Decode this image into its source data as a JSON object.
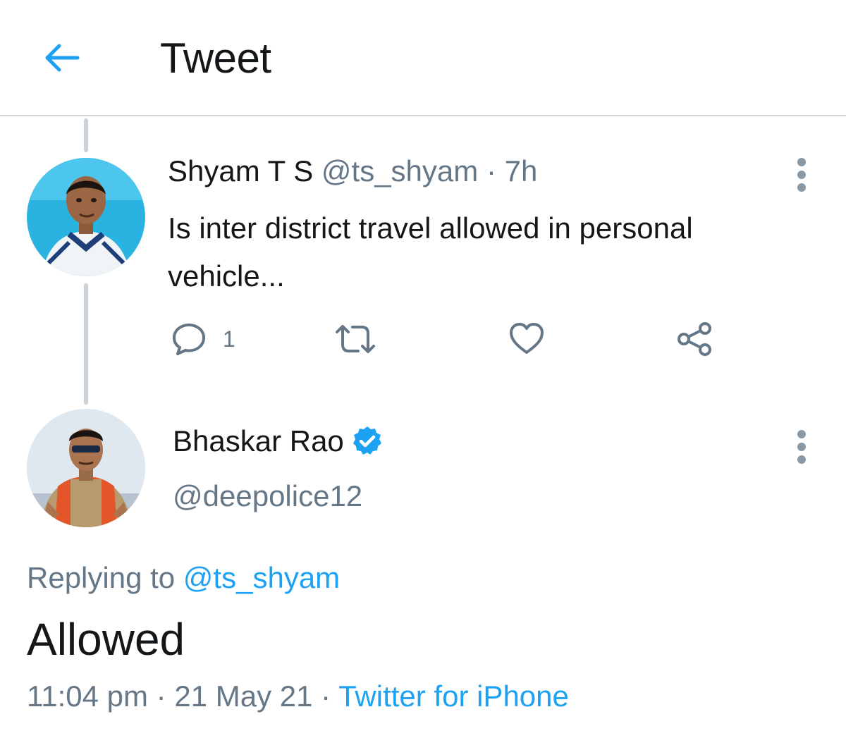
{
  "header": {
    "title": "Tweet",
    "back_icon": "arrow-left-icon"
  },
  "colors": {
    "accent": "#1da1f2",
    "secondary_text": "#657786",
    "primary_text": "#14171a",
    "divider": "#cfd6dc"
  },
  "parent_tweet": {
    "author_name": "Shyam T S",
    "handle": "@ts_shyam",
    "separator": "·",
    "time": "7h",
    "text": "Is inter district travel allowed in personal vehicle...",
    "actions": {
      "reply_count": "1"
    }
  },
  "main_tweet": {
    "author_name": "Bhaskar Rao",
    "verified": true,
    "handle": "@deepolice12",
    "replying_prefix": "Replying to",
    "replying_to": "@ts_shyam",
    "text": "Allowed",
    "time": "11:04 pm",
    "separator": "·",
    "date": "21 May 21",
    "source": "Twitter for iPhone"
  }
}
